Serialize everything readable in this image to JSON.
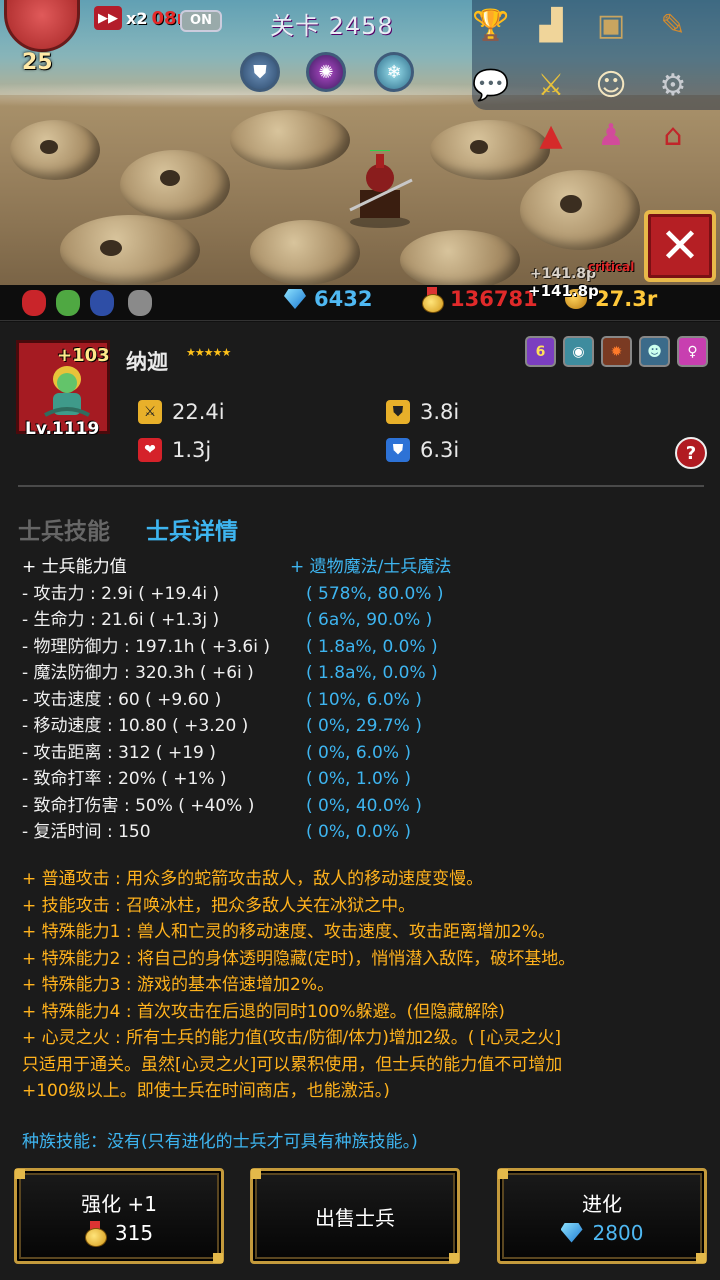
{
  "header": {
    "player_level": "25",
    "speed_multiplier": "x2",
    "speed_timer": "08m",
    "auto_toggle": "ON",
    "stage_title": "关卡 2458"
  },
  "battle": {
    "floating_damage": [
      "+141.8p",
      "+141.8p"
    ],
    "critical_label": "critical"
  },
  "resources": {
    "gems": "6432",
    "medals": "136781",
    "gold": "27.3r"
  },
  "hero": {
    "name": "纳迦",
    "plus_level": "+103",
    "level": "Lv.1119",
    "stars": "★★★★★",
    "attack": "22.4i",
    "defense": "3.8i",
    "health": "1.3j",
    "magic_defense": "6.3i",
    "tag_count": "6"
  },
  "tabs": {
    "skills": "士兵技能",
    "details": "士兵详情"
  },
  "stats_header": {
    "left": "+ 士兵能力值",
    "right": "+ 遗物魔法/士兵魔法"
  },
  "stats": [
    {
      "label": " - 攻击力 : 2.9i ( +19.4i )",
      "bonus": "( 578%, 80.0% )"
    },
    {
      "label": " - 生命力 : 21.6i ( +1.3j )",
      "bonus": "( 6a%, 90.0% )"
    },
    {
      "label": " - 物理防御力 : 197.1h ( +3.6i )",
      "bonus": "( 1.8a%, 0.0% )"
    },
    {
      "label": " - 魔法防御力 : 320.3h ( +6i )",
      "bonus": "( 1.8a%, 0.0% )"
    },
    {
      "label": " - 攻击速度 : 60 ( +9.60 )",
      "bonus": "( 10%, 6.0% )"
    },
    {
      "label": " - 移动速度 : 10.80 ( +3.20 )",
      "bonus": "( 0%, 29.7% )"
    },
    {
      "label": " - 攻击距离 : 312 ( +19 )",
      "bonus": "( 0%, 6.0% )"
    },
    {
      "label": " - 致命打率 : 20% ( +1% )",
      "bonus": "( 0%, 1.0% )"
    },
    {
      "label": " - 致命打伤害 : 50% ( +40% )",
      "bonus": "( 0%, 40.0% )"
    },
    {
      "label": " - 复活时间 : 150",
      "bonus": "( 0%, 0.0% )"
    }
  ],
  "abilities": [
    "+ 普通攻击 : 用众多的蛇箭攻击敌人，敌人的移动速度变慢。",
    "+ 技能攻击 : 召唤冰柱，把众多敌人关在冰狱之中。",
    "+ 特殊能力1 : 兽人和亡灵的移动速度、攻击速度、攻击距离增加2%。",
    "+ 特殊能力2 : 将自己的身体透明隐藏(定时)，悄悄潜入敌阵，破坏基地。",
    "+ 特殊能力3 : 游戏的基本倍速增加2%。",
    "+ 特殊能力4 : 首次攻击在后退的同时100%躲避。(但隐藏解除)",
    "+ 心灵之火 : 所有士兵的能力值(攻击/防御/体力)增加2级。( [心灵之火]",
    "只适用于通关。虽然[心灵之火]可以累积使用，但士兵的能力值不可增加",
    "+100级以上。即使士兵在时间商店，也能激活。)"
  ],
  "race_skill": "种族技能：没有(只有进化的士兵才可具有种族技能。)",
  "buttons": {
    "upgrade_label": "强化 +1",
    "upgrade_cost": "315",
    "sell_label": "出售士兵",
    "evolve_label": "进化",
    "evolve_cost": "2800"
  },
  "colors": {
    "accent_blue": "#3eb5f0",
    "ability_orange": "#ffb21d",
    "medal_red": "#e02a2a",
    "button_border": "#c49a3c"
  }
}
